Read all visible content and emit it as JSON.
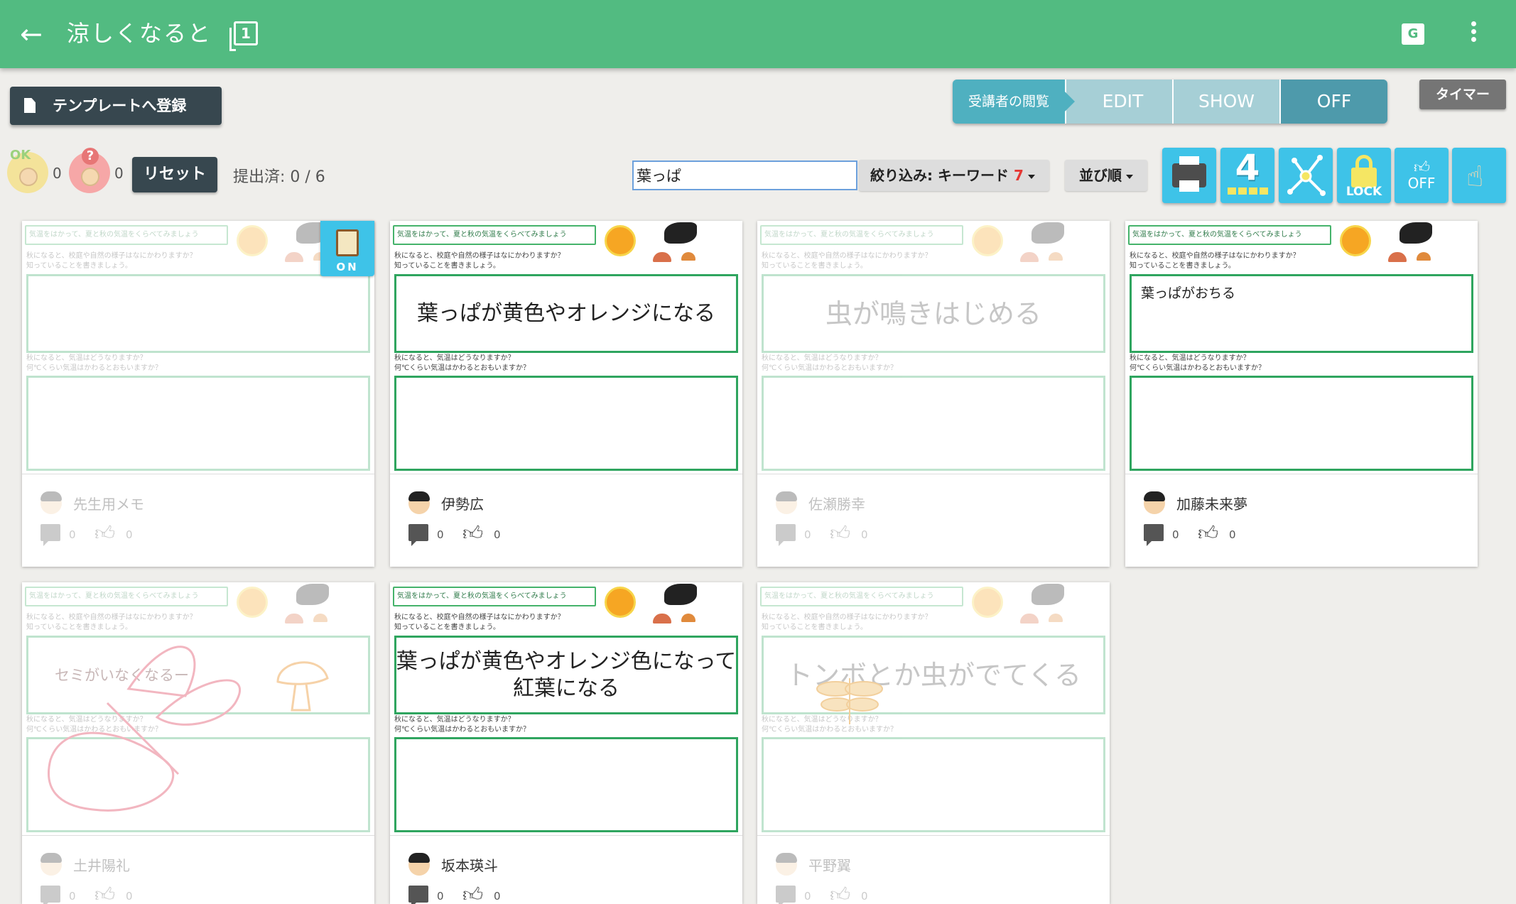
{
  "topbar": {
    "title": "涼しくなると",
    "page_icon_label": "1"
  },
  "toolbar": {
    "template_button": "テンプレートへ登録",
    "view_mode_label": "受講者の閲覧",
    "view_modes": [
      "EDIT",
      "SHOW",
      "OFF"
    ],
    "active_view_mode": "OFF",
    "timer_button": "タイマー"
  },
  "status": {
    "ok_badge": "OK",
    "ok_count": "0",
    "question_badge": "?",
    "question_count": "0",
    "reset_button": "リセット",
    "submitted": "提出済: 0 / 6"
  },
  "search": {
    "value": "葉っぱ",
    "placeholder": ""
  },
  "filter": {
    "label": "絞り込み: キーワード",
    "count": "7"
  },
  "sort": {
    "label": "並び順"
  },
  "tools": {
    "four_label": "4",
    "lock_label": "LOCK",
    "off_label": "OFF"
  },
  "sheet": {
    "header": "気温をはかって、夏と秋の気温をくらべてみましょう",
    "q1_line1": "秋になると、校庭や自然の様子はなにかわりますか？",
    "q1_line2": "知っていることを書きましょう。",
    "q2_line1": "秋になると、気温はどうなりますか？",
    "q2_line2": "何℃くらい気温はかわるとおもいますか？"
  },
  "cards": [
    {
      "name": "先生用メモ",
      "answer": "",
      "comments": "0",
      "likes": "0",
      "on_badge": "ON"
    },
    {
      "name": "伊勢広",
      "answer": "葉っぱが黄色やオレンジになる",
      "comments": "0",
      "likes": "0"
    },
    {
      "name": "佐瀬勝幸",
      "answer": "虫が鳴きはじめる",
      "comments": "0",
      "likes": "0"
    },
    {
      "name": "加藤未来夢",
      "answer": "葉っぱがおちる",
      "comments": "0",
      "likes": "0"
    },
    {
      "name": "土井陽礼",
      "answer": "セミがいなくなるー",
      "comments": "0",
      "likes": "0"
    },
    {
      "name": "坂本瑛斗",
      "answer": "葉っぱが黄色やオレンジ色になって紅葉になる",
      "comments": "0",
      "likes": "0"
    },
    {
      "name": "平野翼",
      "answer": "トンボとか虫がでてくる",
      "comments": "0",
      "likes": "0"
    }
  ],
  "colors": {
    "topbar": "#52bb81",
    "accent": "#3ec3e8",
    "dark_button": "#37474f",
    "sheet_border": "#2fa55f",
    "filter_count": "#e53935"
  }
}
